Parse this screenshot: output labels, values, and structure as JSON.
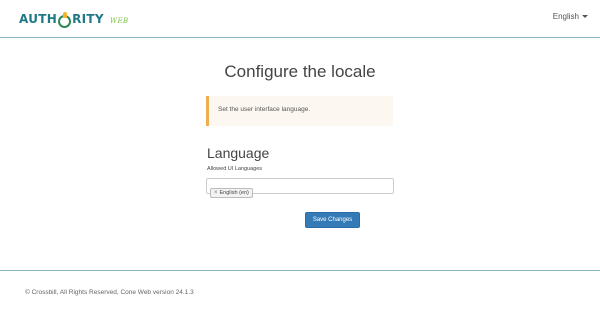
{
  "navbar": {
    "brand_main_left": "AUTH",
    "brand_main_right": "RITY",
    "brand_sub": "WEB",
    "language_label": "English",
    "accent_color": "#1f7a86"
  },
  "main": {
    "title": "Configure the locale",
    "alert_text": "Set the user interface language.",
    "section_title": "Language",
    "field_label": "Allowed UI Languages",
    "selected_languages": [
      "English (en)"
    ],
    "tag_remove_symbol": "×",
    "save_button_label": "Save Changes",
    "button_color": "#337ab7"
  },
  "footer": {
    "text": "© Crossbill, All Rights Reserved, Cone Web version 24.1.3"
  }
}
